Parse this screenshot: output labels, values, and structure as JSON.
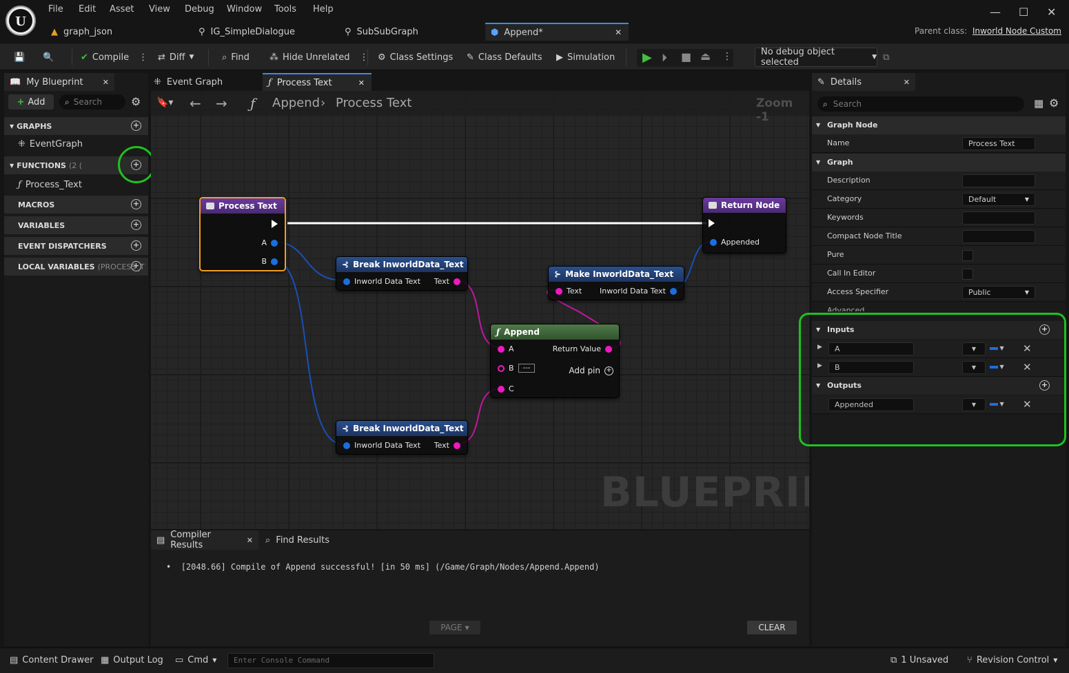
{
  "menu": [
    "File",
    "Edit",
    "Asset",
    "View",
    "Debug",
    "Window",
    "Tools",
    "Help"
  ],
  "doc_tabs": [
    {
      "label": "graph_json"
    },
    {
      "label": "IG_SimpleDialogue"
    },
    {
      "label": "SubSubGraph"
    },
    {
      "label": "Append*"
    }
  ],
  "parent_class": {
    "label": "Parent class:",
    "value": "Inworld Node Custom"
  },
  "toolbar": {
    "compile": "Compile",
    "diff": "Diff",
    "find": "Find",
    "hide_unrelated": "Hide Unrelated",
    "class_settings": "Class Settings",
    "class_defaults": "Class Defaults",
    "simulation": "Simulation",
    "debug_object": "No debug object selected"
  },
  "my_blueprint": {
    "tab": "My Blueprint",
    "add": "Add",
    "search_placeholder": "Search",
    "sections": {
      "graphs": "GRAPHS",
      "functions": "FUNCTIONS",
      "functions_count": "(2 (",
      "macros": "MACROS",
      "variables": "VARIABLES",
      "event_dispatchers": "EVENT DISPATCHERS",
      "local_variables": "LOCAL VARIABLES",
      "local_variables_scope": "(PROCESS_T"
    },
    "items": {
      "event_graph": "EventGraph",
      "process_text": "Process_Text"
    }
  },
  "graph_tabs": {
    "event_graph": "Event Graph",
    "process_text": "Process Text"
  },
  "breadcrumb": {
    "root": "Append",
    "leaf": "Process Text",
    "zoom": "Zoom -1"
  },
  "watermark": "BLUEPRINT",
  "nodes": {
    "entry": {
      "title": "Process Text",
      "pin_a": "A",
      "pin_b": "B"
    },
    "return": {
      "title": "Return Node",
      "pin": "Appended"
    },
    "break1": {
      "title": "Break InworldData_Text",
      "in": "Inworld Data Text",
      "out": "Text"
    },
    "break2": {
      "title": "Break InworldData_Text",
      "in": "Inworld Data Text",
      "out": "Text"
    },
    "make": {
      "title": "Make InworldData_Text",
      "in": "Text",
      "out": "Inworld Data Text"
    },
    "append": {
      "title": "Append",
      "a": "A",
      "b": "B",
      "b_value": "---",
      "c": "C",
      "ret": "Return Value",
      "add_pin": "Add pin"
    }
  },
  "bottom": {
    "tab_compiler": "Compiler Results",
    "tab_find": "Find Results",
    "log": "[2048.66] Compile of Append successful! [in 50 ms] (/Game/Graph/Nodes/Append.Append)",
    "page": "PAGE",
    "clear": "CLEAR"
  },
  "details": {
    "tab": "Details",
    "search_placeholder": "Search",
    "graph_node": "Graph Node",
    "name_label": "Name",
    "name_value": "Process Text",
    "graph": "Graph",
    "description": "Description",
    "category": "Category",
    "category_value": "Default",
    "keywords": "Keywords",
    "compact_title": "Compact Node Title",
    "pure": "Pure",
    "call_in_editor": "Call In Editor",
    "access_specifier": "Access Specifier",
    "access_value": "Public",
    "advanced": "Advanced",
    "inputs": "Inputs",
    "input_a": "A",
    "input_b": "B",
    "outputs": "Outputs",
    "output_appended": "Appended"
  },
  "status": {
    "content_drawer": "Content Drawer",
    "output_log": "Output Log",
    "cmd": "Cmd",
    "console_placeholder": "Enter Console Command",
    "unsaved": "1 Unsaved",
    "revision": "Revision Control"
  },
  "colors": {
    "accent": "#3a8de0",
    "highlight": "#1ec21e",
    "exec": "#ffffff",
    "pin_struct": "#1a6fe0",
    "pin_text": "#f018c0",
    "function_head": "#5a2a8a",
    "pure_head": "#1f3c6e",
    "append_head": "#3d6b3a"
  }
}
